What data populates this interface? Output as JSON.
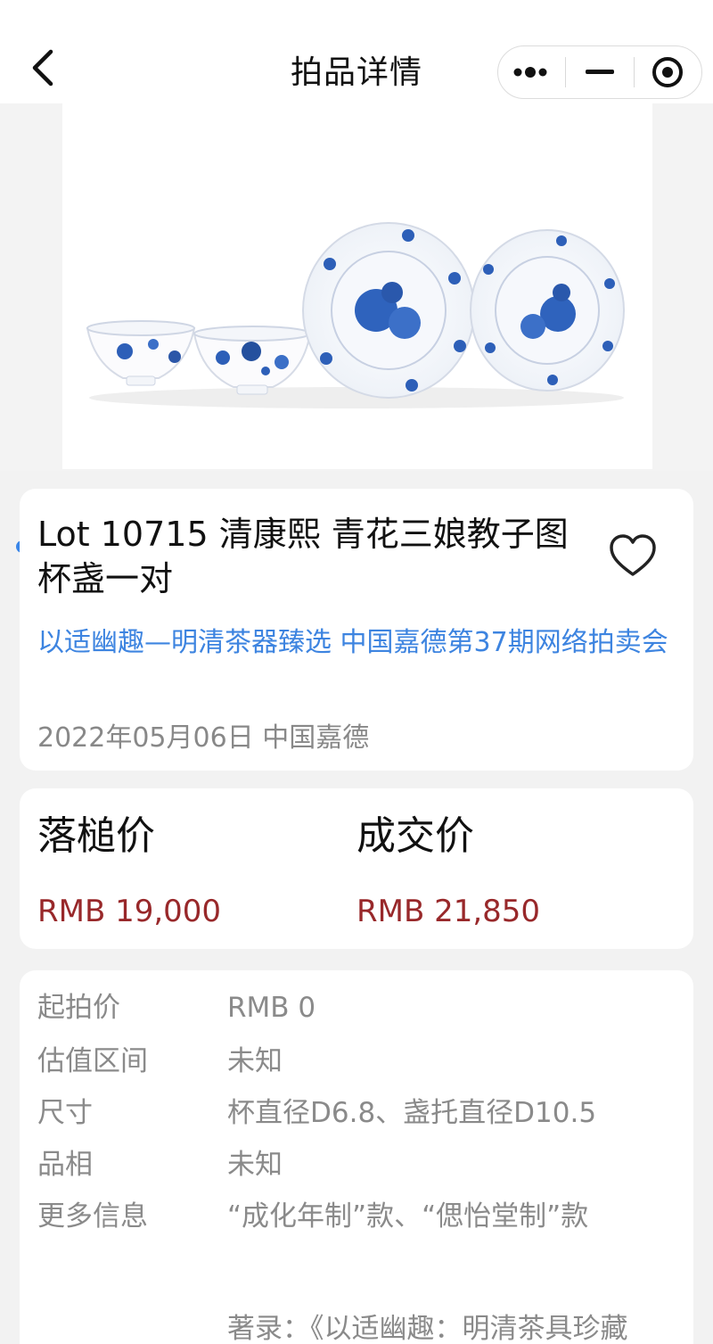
{
  "header": {
    "title": "拍品详情"
  },
  "gallery": {
    "image_alt": "blue-and-white porcelain cups and saucers",
    "dot_count": 23,
    "active_index": 0,
    "accent": "#3a86e8"
  },
  "lot": {
    "title": "Lot 10715 清康熙 青花三娘教子图杯盏一对",
    "sale": "以适幽趣—明清茶器臻选 中国嘉德第37期网络拍卖会",
    "date_house": "2022年05月06日 中国嘉德"
  },
  "prices": {
    "hammer_label": "落槌价",
    "hammer_value": "RMB 19,000",
    "deal_label": "成交价",
    "deal_value": "RMB 21,850",
    "price_color": "#98282a"
  },
  "details": [
    {
      "key": "起拍价",
      "value": "RMB 0"
    },
    {
      "key": "估值区间",
      "value": "未知"
    },
    {
      "key": "尺寸",
      "value": "杯直径D6.8、盏托直径D10.5"
    },
    {
      "key": "品相",
      "value": "未知"
    },
    {
      "key": "更多信息",
      "value": "“成化年制”款、“偲怡堂制”款"
    }
  ],
  "more_text": "著录：《以适幽趣：明清茶具珍藏"
}
